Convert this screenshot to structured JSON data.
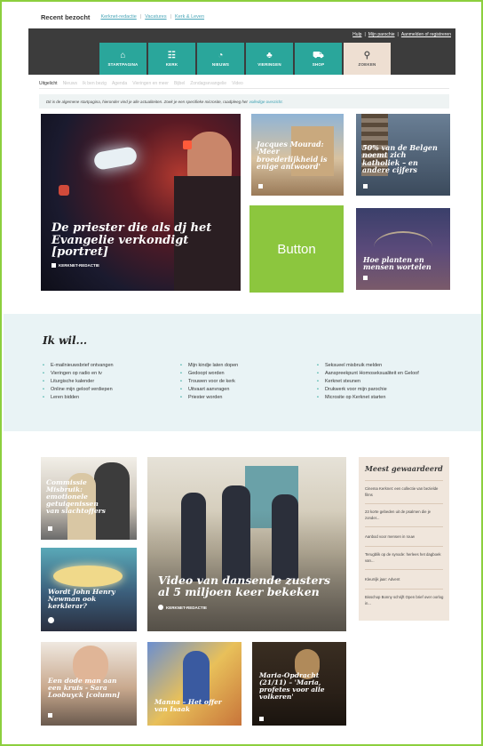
{
  "recent": {
    "label": "Recent bezocht",
    "links": [
      "Kerknet-redactie",
      "Vacatures",
      "Kerk & Leven"
    ]
  },
  "toplinks": {
    "help": "Hulp",
    "parish": "Mijn parochie",
    "login": "Aanmelden of registreren"
  },
  "nav": [
    {
      "label": "STARTPAGINA",
      "icon": "home-icon"
    },
    {
      "label": "KERK",
      "icon": "people-icon"
    },
    {
      "label": "NIEUWS",
      "icon": "news-icon"
    },
    {
      "label": "VIERINGEN",
      "icon": "celebration-icon"
    },
    {
      "label": "SHOP",
      "icon": "cart-icon"
    },
    {
      "label": "ZOEKEN",
      "icon": "search-icon"
    }
  ],
  "tabs": [
    "Uitgelicht",
    "Nieuws",
    "Ik ben bezig",
    "Agenda",
    "Vieringen en meer",
    "Bijbel",
    "Zondagsevangelie",
    "Video"
  ],
  "info": {
    "text": "Dit is de algemene startpagina, hieronder vind je alle actualiteiten. Zoek je een specifieke microsite, raadpleeg het",
    "link": "volledige overzicht."
  },
  "hero": {
    "title": "De priester die als dj het Evangelie verkondigt [portret]",
    "author": "KERKNET-REDACTIE"
  },
  "cards_top": [
    {
      "title": "Jacques Mourad: 'Meer broederlijkheid is enige antwoord'"
    },
    {
      "title": "50% van de Belgen noemt zich katholiek – en andere cijfers"
    },
    {
      "title": "Hoe planten en mensen wortelen"
    }
  ],
  "button": {
    "label": "Button"
  },
  "ikwil": {
    "title": "Ik wil...",
    "col1": [
      "E-mailnieuwsbrief ontvangen",
      "Vieringen op radio en tv",
      "Liturgische kalender",
      "Online mijn geloof verdiepen",
      "Leren bidden"
    ],
    "col2": [
      "Mijn kindje laten dopen",
      "Gedoopt worden",
      "Trouwen voor de kerk",
      "Uitvaart aanvragen",
      "Priester worden"
    ],
    "col3": [
      "Seksueel misbruik melden",
      "Aanspreekpunt Homoseksualiteit en Geloof",
      "Kerknet steunen",
      "Drukwerk voor mijn parochie",
      "Microsite op Kerknet starten"
    ]
  },
  "cards_mid": [
    {
      "title": "Commissie Misbruik: emotionele getuigenissen van slachtoffers"
    },
    {
      "title": "Wordt John Henry Newman ook kerklerar?"
    }
  ],
  "video": {
    "title": "Video van dansende zusters al 5 miljoen keer bekeken",
    "author": "KERKNET-REDACTIE"
  },
  "sidebar": {
    "title": "Meest gewaardeerd",
    "items": [
      "Cinema Kerknet: een collectie van bezielde films",
      "23 korte gebeden uit de psalmen die je zonder...",
      "Aanbod voor mensen in rouw",
      "Terugblik op de synode: herlees het dagboek van...",
      "Kleurrijk jaar: Advent",
      "Bisschop Bonny schrijft Open brief over oorlog in..."
    ]
  },
  "cards_bottom": [
    {
      "title": "Een dode man aan een kruis - Sara Loobuyck [column]"
    },
    {
      "title": "Manna – Het offer van Isaak"
    },
    {
      "title": "Maria-Opdracht (21/11) – 'Maria, profetes voor alle volkeren'"
    }
  ],
  "colors": {
    "teal": "#2aa69b",
    "green": "#8cc63e",
    "dark": "#3c3c3c",
    "beige": "#eedfd2"
  }
}
